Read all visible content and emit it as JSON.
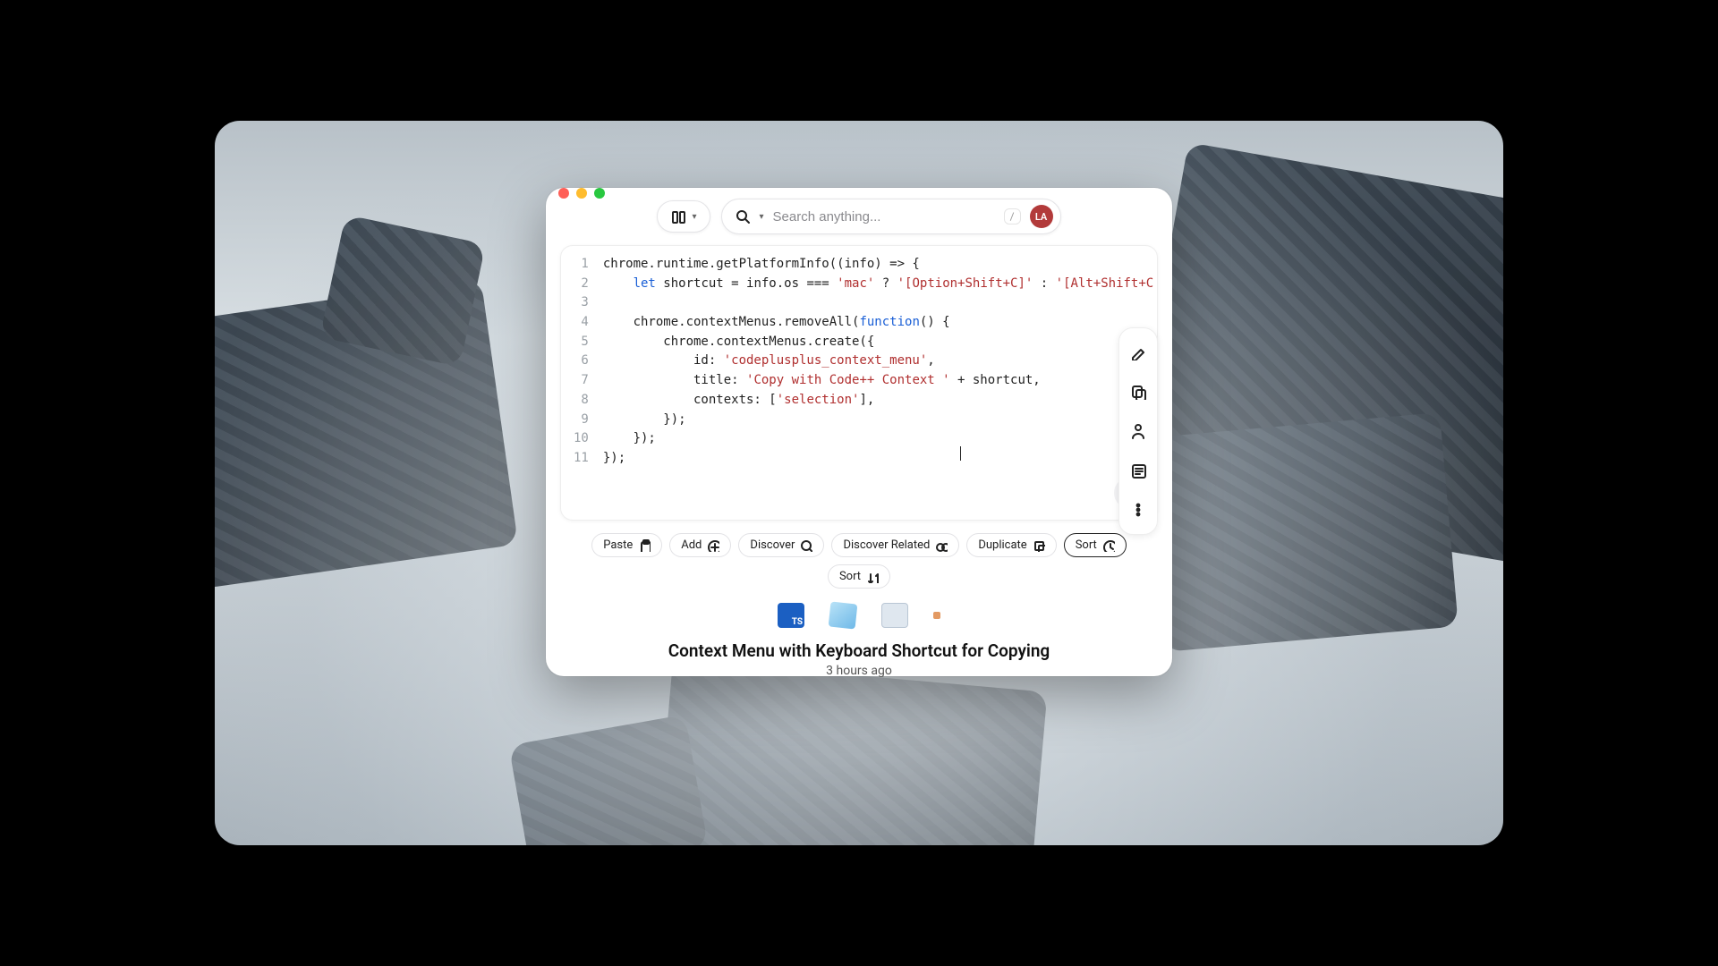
{
  "search": {
    "placeholder": "Search anything...",
    "kbd": "/"
  },
  "avatar": "LA",
  "code": {
    "lines": [
      "1",
      "2",
      "3",
      "4",
      "5",
      "6",
      "7",
      "8",
      "9",
      "10",
      "11"
    ],
    "l1a": "chrome.runtime.getPlatformInfo((info) => {",
    "l2a": "    ",
    "l2kw": "let",
    "l2b": " shortcut = info.os === ",
    "l2s1": "'mac'",
    "l2c": " ? ",
    "l2s2": "'[Option+Shift+C]'",
    "l2d": " : ",
    "l2s3": "'[Alt+Shift+C",
    "l3": "",
    "l4a": "    chrome.contextMenus.removeAll(",
    "l4fn": "function",
    "l4b": "() {",
    "l5": "        chrome.contextMenus.create({",
    "l6a": "            id: ",
    "l6s": "'codeplusplus_context_menu'",
    "l6b": ",",
    "l7a": "            title: ",
    "l7s": "'Copy with Code++ Context '",
    "l7b": " + shortcut,",
    "l8a": "            contexts: [",
    "l8s": "'selection'",
    "l8b": "],",
    "l9": "        });",
    "l10": "    });",
    "l11": "});"
  },
  "chips": {
    "paste": "Paste",
    "add": "Add",
    "discover": "Discover",
    "discover_related": "Discover Related",
    "duplicate": "Duplicate",
    "sort1": "Sort",
    "sort2": "Sort"
  },
  "meta": {
    "title": "Context Menu with Keyboard Shortcut for Copying",
    "time": "3 hours ago"
  }
}
